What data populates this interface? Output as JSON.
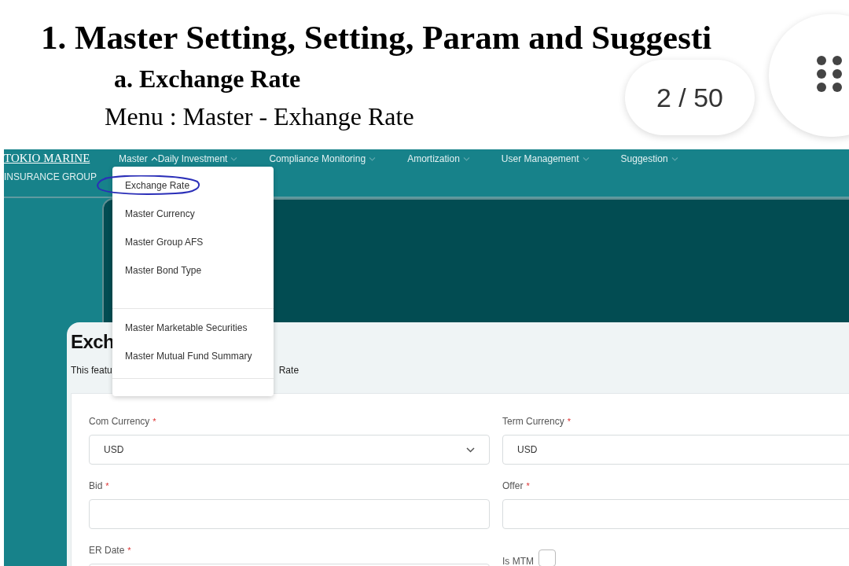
{
  "document": {
    "heading": "1. Master Setting, Setting, Param and Suggesti",
    "subheading": "a. Exchange Rate",
    "menu_path": "Menu : Master - Exhange Rate"
  },
  "viewer": {
    "page_counter": "2 / 50"
  },
  "app": {
    "logo_top": "TOKIO MARINE",
    "logo_bottom": "INSURANCE GROUP",
    "nav": [
      {
        "label": "Master",
        "expanded": true
      },
      {
        "label": "Daily Investment",
        "expanded": false
      },
      {
        "label": "Compliance Monitoring",
        "expanded": false
      },
      {
        "label": "Amortization",
        "expanded": false
      },
      {
        "label": "User Management",
        "expanded": false
      },
      {
        "label": "Suggestion",
        "expanded": false
      }
    ],
    "dropdown": {
      "groups": [
        [
          {
            "label": "Exchange Rate",
            "annotated": true
          },
          {
            "label": "Master Currency",
            "annotated": false
          },
          {
            "label": "Master Group AFS",
            "annotated": false
          },
          {
            "label": "Master Bond Type",
            "annotated": false
          }
        ],
        [
          {
            "label": "Master Marketable Securities",
            "annotated": false
          },
          {
            "label": "Master Mutual Fund Summary",
            "annotated": false
          }
        ]
      ]
    },
    "page_title": "Exch",
    "description_start": "This featu",
    "description_end": "Rate",
    "form": [
      [
        {
          "kind": "select",
          "label": "Com Currency",
          "required_mark": "*",
          "value": "USD"
        },
        {
          "kind": "select",
          "label": "Term Currency",
          "required_mark": "*",
          "value": "USD"
        }
      ],
      [
        {
          "kind": "text",
          "label": "Bid",
          "required_mark": "*"
        },
        {
          "kind": "text",
          "label": "Offer",
          "required_mark": "*"
        }
      ],
      [
        {
          "kind": "date",
          "label": "ER Date",
          "required_mark": "*"
        },
        {
          "kind": "checkbox",
          "label": "Is MTM",
          "checked": false
        }
      ]
    ]
  }
}
